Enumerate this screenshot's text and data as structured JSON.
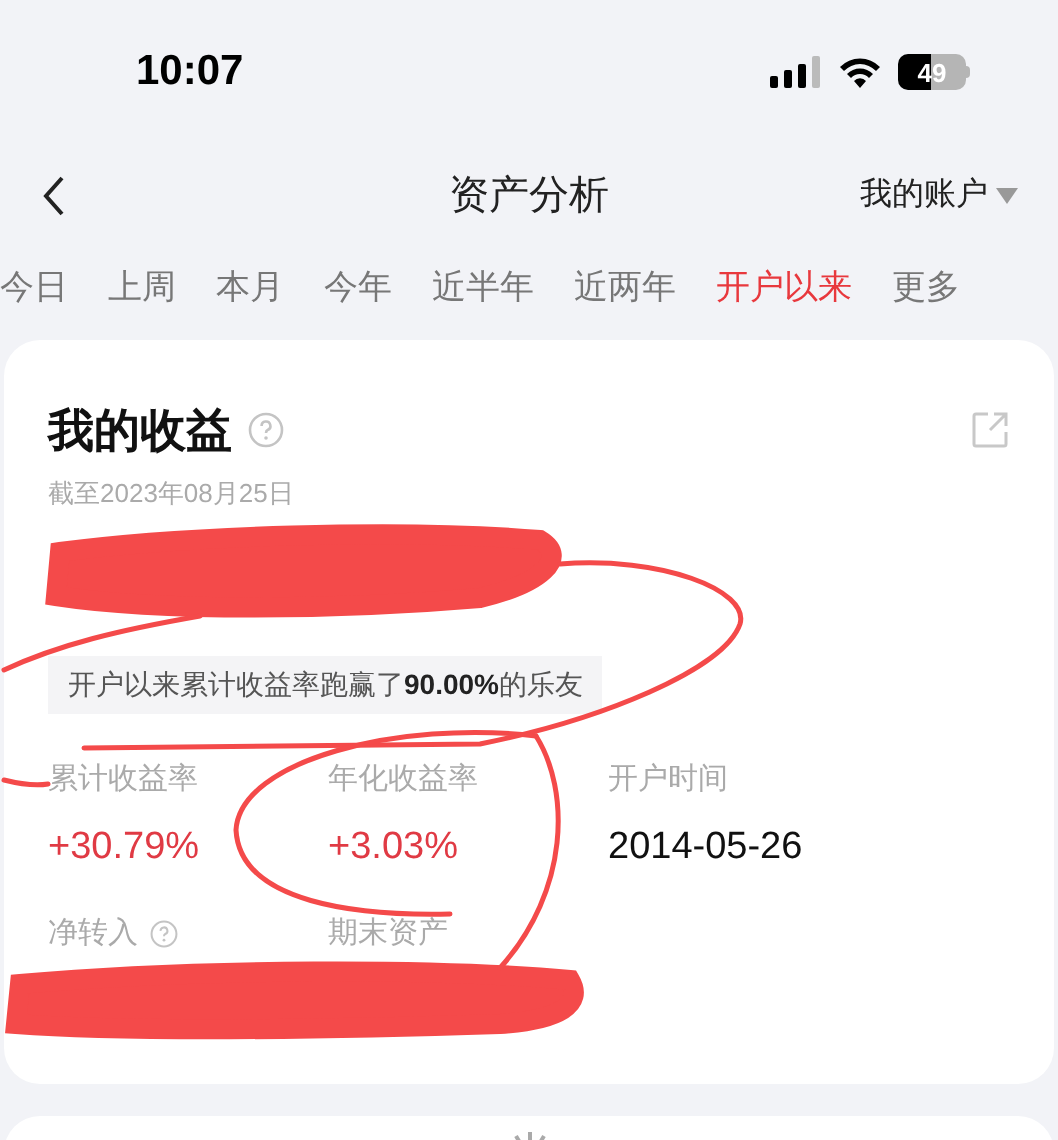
{
  "status_bar": {
    "time": "10:07",
    "battery": "49"
  },
  "nav": {
    "title": "资产分析",
    "account": "我的账户"
  },
  "tabs": [
    {
      "label": "今日",
      "selected": false
    },
    {
      "label": "上周",
      "selected": false
    },
    {
      "label": "本月",
      "selected": false
    },
    {
      "label": "今年",
      "selected": false
    },
    {
      "label": "近半年",
      "selected": false
    },
    {
      "label": "近两年",
      "selected": false
    },
    {
      "label": "开户以来",
      "selected": true
    },
    {
      "label": "更多",
      "selected": false
    }
  ],
  "card": {
    "title": "我的收益",
    "date": "截至2023年08月25日",
    "rank_note": "开户以来累计收益率跑赢了**90.00%**的乐友",
    "stats": [
      {
        "label": "累计收益率",
        "value": "+30.79%",
        "kind": "gain"
      },
      {
        "label": "年化收益率",
        "value": "+3.03%",
        "kind": "gain"
      },
      {
        "label": "开户时间",
        "value": "2014-05-26",
        "kind": "plain"
      }
    ],
    "bottom_labels": [
      {
        "label": "净转入",
        "help": true
      },
      {
        "label": "期末资产",
        "help": false
      }
    ]
  }
}
